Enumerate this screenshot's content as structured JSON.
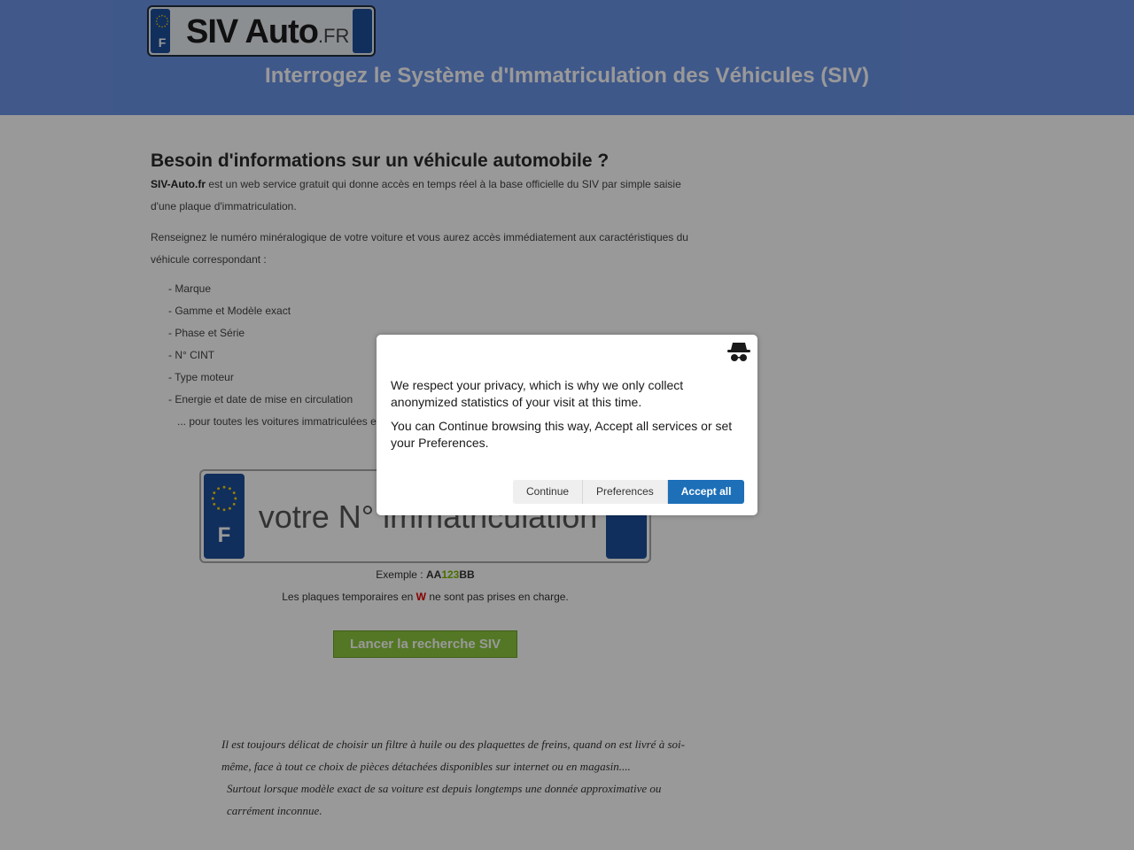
{
  "header": {
    "logo": {
      "text": "SIV Auto",
      "tld": ".FR",
      "country": "F"
    },
    "title": "Interrogez le Système d'Immatriculation des Véhicules (SIV)"
  },
  "intro": {
    "heading": "Besoin d'informations sur un véhicule automobile ?",
    "brand": "SIV-Auto.fr",
    "p1": " est un web service gratuit qui donne accès en temps réel à la base officielle du SIV par simple saisie d'une plaque d'immatriculation.",
    "p2": "Renseignez le numéro minéralogique de votre voiture et vous aurez accès immédiatement aux caractéristiques du véhicule correspondant :",
    "features": [
      "- Marque",
      "- Gamme et Modèle exact",
      "- Phase et Série",
      "- N° CINT",
      "- Type moteur",
      "- Energie et date de mise en circulation"
    ],
    "features_more": "... pour toutes les voitures immatriculées e"
  },
  "plate": {
    "country": "F",
    "placeholder": "votre N° immatriculation"
  },
  "example": {
    "prefix": "Exemple : ",
    "part1": "AA",
    "part2": "123",
    "part3": "BB"
  },
  "temp_notice": {
    "before": "Les plaques temporaires en ",
    "letter": "W",
    "after": " ne sont pas prises en charge."
  },
  "search_button": "Lancer la recherche SIV",
  "italic": {
    "line1": "Il est toujours délicat de choisir un filtre à huile ou des plaquettes de freins, quand on est livré à soi-même, face à tout ce choix de pièces détachées disponibles sur internet ou en magasin....",
    "line2": "Surtout lorsque modèle exact de sa voiture est depuis longtemps une donnée approximative ou carrément inconnue."
  },
  "cookie_modal": {
    "icon": "incognito-icon",
    "text1": "We respect your privacy, which is why we only collect anonymized statistics of your visit at this time.",
    "text2": "You can Continue browsing this way, Accept all services or set your Preferences.",
    "buttons": {
      "continue": "Continue",
      "preferences": "Preferences",
      "accept_all": "Accept all"
    }
  },
  "colors": {
    "header_bg": "#6a93e6",
    "plate_blue": "#1d4f9c",
    "button_green": "#8cc63f",
    "accept_blue": "#1d6fb8",
    "warning_red": "#e00000"
  }
}
